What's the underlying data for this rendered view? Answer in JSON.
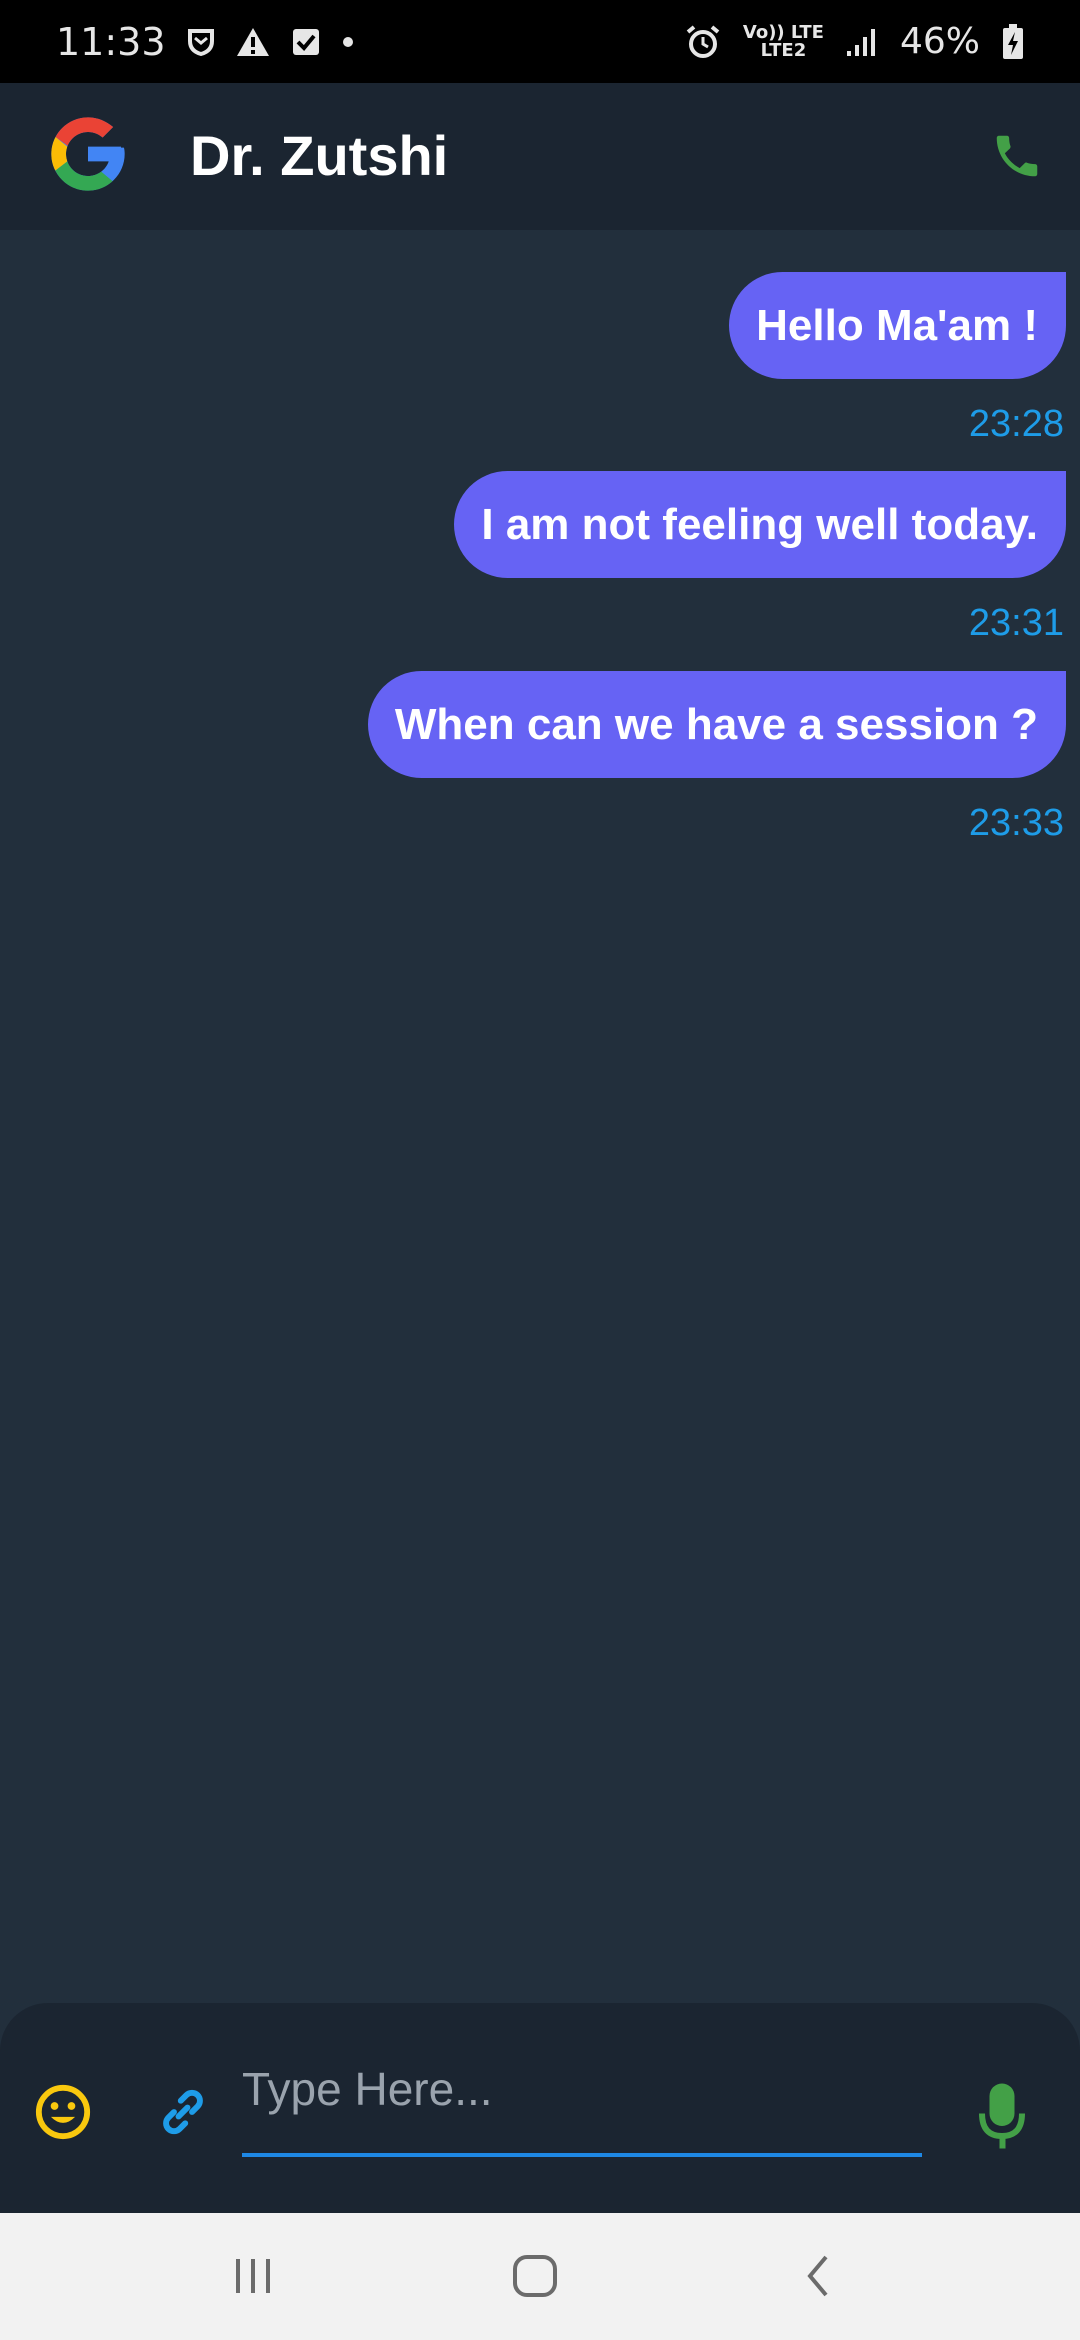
{
  "status_bar": {
    "time": "11:33",
    "net_top": "Vo)) LTE",
    "net_bottom": "LTE2",
    "battery": "46%",
    "icons": [
      "shield-icon",
      "warning-icon",
      "checkbox-icon",
      "dot-icon",
      "alarm-icon",
      "network-icon",
      "signal-icon",
      "battery-charging-icon"
    ]
  },
  "header": {
    "contact_name": "Dr. Zutshi",
    "logo_icon": "google-logo-icon",
    "call_icon": "phone-icon"
  },
  "messages": [
    {
      "text": "Hello Ma'am !",
      "time": "23:28"
    },
    {
      "text": "I am not feeling well today.",
      "time": "23:31"
    },
    {
      "text": "When can we have a session ?",
      "time": "23:33"
    }
  ],
  "input_bar": {
    "placeholder": "Type Here...",
    "value": "",
    "emoji_icon": "emoji-icon",
    "attach_icon": "link-icon",
    "mic_icon": "mic-icon"
  },
  "nav_bar": {
    "icons": [
      "recents-icon",
      "home-icon",
      "back-icon"
    ]
  },
  "colors": {
    "background": "#222f3c",
    "header": "#1b2531",
    "bubble": "#6663f4",
    "timestamp": "#1e9ce8",
    "call_green": "#43a047",
    "emoji_yellow": "#f9c80e",
    "input_underline": "#1e88e5"
  }
}
